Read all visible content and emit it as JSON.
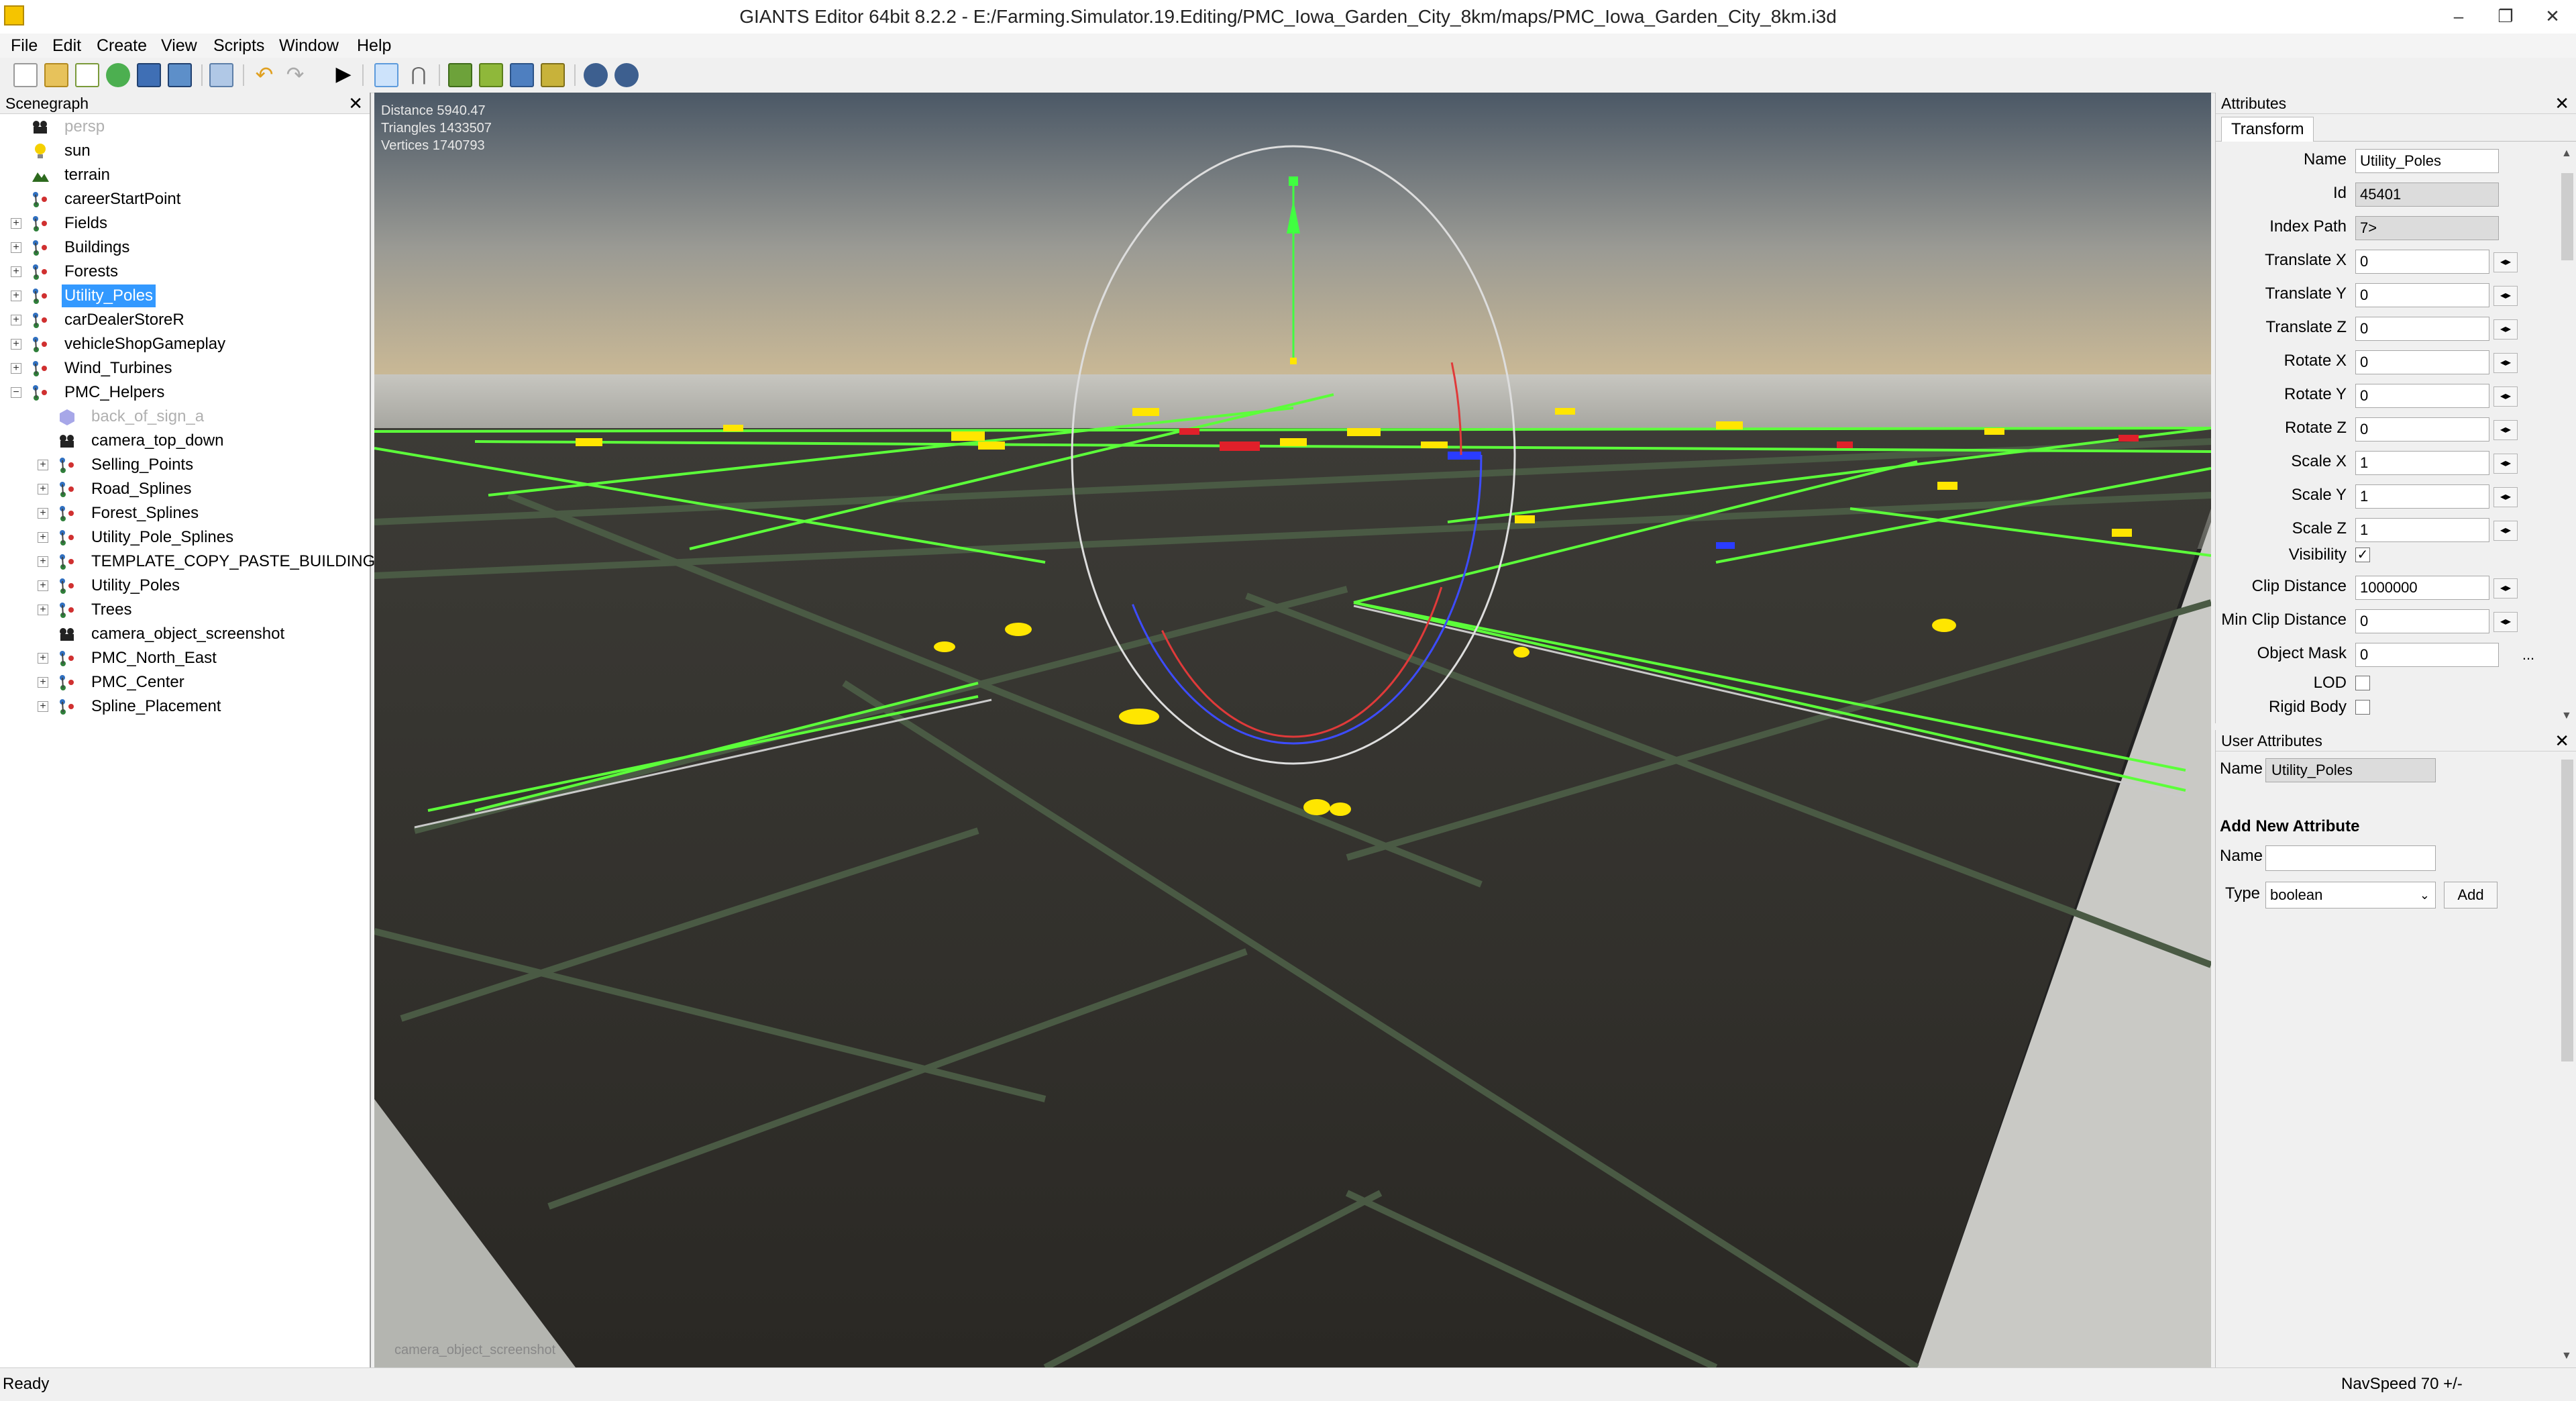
{
  "window": {
    "title": "GIANTS Editor 64bit 8.2.2 - E:/Farming.Simulator.19.Editing/PMC_Iowa_Garden_City_8km/maps/PMC_Iowa_Garden_City_8km.i3d",
    "minimize": "–",
    "maximize": "❐",
    "close": "✕"
  },
  "menu": [
    "File",
    "Edit",
    "Create",
    "View",
    "Scripts",
    "Window",
    "Help"
  ],
  "scenegraph": {
    "title": "Scenegraph",
    "close": "✕",
    "nodes": [
      {
        "label": "persp",
        "icon": "camera-icon",
        "disabled": true
      },
      {
        "label": "sun",
        "icon": "light-bulb-icon"
      },
      {
        "label": "terrain",
        "icon": "terrain-icon"
      },
      {
        "label": "careerStartPoint",
        "icon": "transform-group-icon"
      },
      {
        "label": "Fields",
        "icon": "transform-group-icon"
      },
      {
        "label": "Buildings",
        "icon": "transform-group-icon"
      },
      {
        "label": "Forests",
        "icon": "transform-group-icon"
      },
      {
        "label": "Utility_Poles",
        "icon": "transform-group-icon",
        "selected": true
      },
      {
        "label": "carDealerStoreR",
        "icon": "transform-group-icon"
      },
      {
        "label": "vehicleShopGameplay",
        "icon": "transform-group-icon"
      },
      {
        "label": "Wind_Turbines",
        "icon": "transform-group-icon"
      },
      {
        "label": "PMC_Helpers",
        "icon": "transform-group-icon"
      },
      {
        "label": "back_of_sign_a",
        "icon": "shape-icon",
        "disabled": true
      },
      {
        "label": "camera_top_down",
        "icon": "camera-icon"
      },
      {
        "label": "Selling_Points",
        "icon": "transform-group-icon"
      },
      {
        "label": "Road_Splines",
        "icon": "transform-group-icon"
      },
      {
        "label": "Forest_Splines",
        "icon": "transform-group-icon"
      },
      {
        "label": "Utility_Pole_Splines",
        "icon": "transform-group-icon"
      },
      {
        "label": "TEMPLATE_COPY_PASTE_BUILDING",
        "icon": "transform-group-icon"
      },
      {
        "label": "Utility_Poles",
        "icon": "transform-group-icon"
      },
      {
        "label": "Trees",
        "icon": "transform-group-icon"
      },
      {
        "label": "camera_object_screenshot",
        "icon": "camera-icon"
      },
      {
        "label": "PMC_North_East",
        "icon": "transform-group-icon"
      },
      {
        "label": "PMC_Center",
        "icon": "transform-group-icon"
      },
      {
        "label": "Spline_Placement",
        "icon": "transform-group-icon"
      }
    ]
  },
  "viewport": {
    "stats": [
      "Distance 5940.47",
      "Triangles 1433507",
      "Vertices 1740793"
    ],
    "camera_label": "camera_object_screenshot"
  },
  "attributes": {
    "title": "Attributes",
    "close": "✕",
    "tab": "Transform",
    "name_label": "Name",
    "name_value": "Utility_Poles",
    "id_label": "Id",
    "id_value": "45401",
    "index_path_label": "Index Path",
    "index_path_value": "7>",
    "fields": [
      {
        "label": "Translate X",
        "value": "0"
      },
      {
        "label": "Translate Y",
        "value": "0"
      },
      {
        "label": "Translate Z",
        "value": "0"
      },
      {
        "label": "Rotate X",
        "value": "0"
      },
      {
        "label": "Rotate Y",
        "value": "0"
      },
      {
        "label": "Rotate Z",
        "value": "0"
      },
      {
        "label": "Scale X",
        "value": "1"
      },
      {
        "label": "Scale Y",
        "value": "1"
      },
      {
        "label": "Scale Z",
        "value": "1"
      }
    ],
    "visibility_label": "Visibility",
    "visibility_checked": "✓",
    "clip_distance_label": "Clip Distance",
    "clip_distance_value": "1000000",
    "min_clip_label": "Min Clip Distance",
    "min_clip_value": "0",
    "object_mask_label": "Object Mask",
    "object_mask_value": "0",
    "ellipsis": "...",
    "lod_label": "LOD",
    "rigid_body_label": "Rigid Body",
    "spin_glyph": "◂▸"
  },
  "user_attributes": {
    "title": "User Attributes",
    "close": "✕",
    "name_label": "Name",
    "name_value": "Utility_Poles",
    "add_new_title": "Add New Attribute",
    "new_name_label": "Name",
    "new_name_value": "",
    "type_label": "Type",
    "type_value": "boolean",
    "add_button": "Add"
  },
  "status": {
    "left": "Ready",
    "right": "NavSpeed 70 +/-"
  },
  "colors": {
    "selection": "#3399ff",
    "spline_green": "#5cff3a",
    "marker_yellow": "#ffe600",
    "marker_red": "#e0202a",
    "marker_blue": "#2a3cff",
    "field_dark": "#2e2c28",
    "road_green": "#4a5a44"
  }
}
